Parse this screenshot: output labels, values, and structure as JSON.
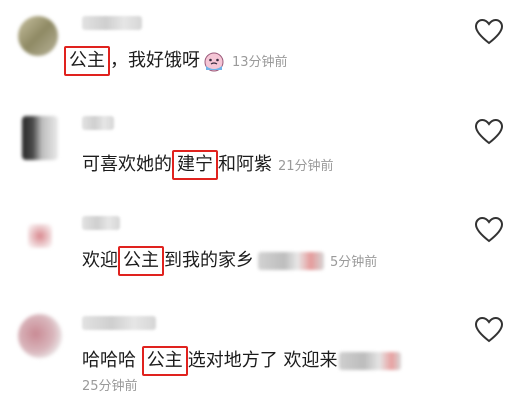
{
  "comments": [
    {
      "parts": {
        "highlight": "公主",
        "after": "，我好饿呀"
      },
      "time": "13分钟前",
      "emoji": "crying-face-emoji",
      "liked": false
    },
    {
      "parts": {
        "before": "可喜欢她的",
        "highlight": "建宁",
        "after": "和阿紫"
      },
      "time": "21分钟前",
      "liked": false
    },
    {
      "parts": {
        "before": "欢迎",
        "highlight": "公主",
        "after": "到我的家乡"
      },
      "time": "5分钟前",
      "liked": false
    },
    {
      "parts": {
        "before": "哈哈哈 ",
        "highlight": "公主",
        "after": "选对地方了 欢迎来"
      },
      "time": "25分钟前",
      "liked": false
    }
  ],
  "colors": {
    "highlight_border": "#e0221e",
    "time": "#9a9a9a",
    "heart_stroke": "#333333"
  },
  "icons": {
    "like": "heart-outline-icon"
  }
}
